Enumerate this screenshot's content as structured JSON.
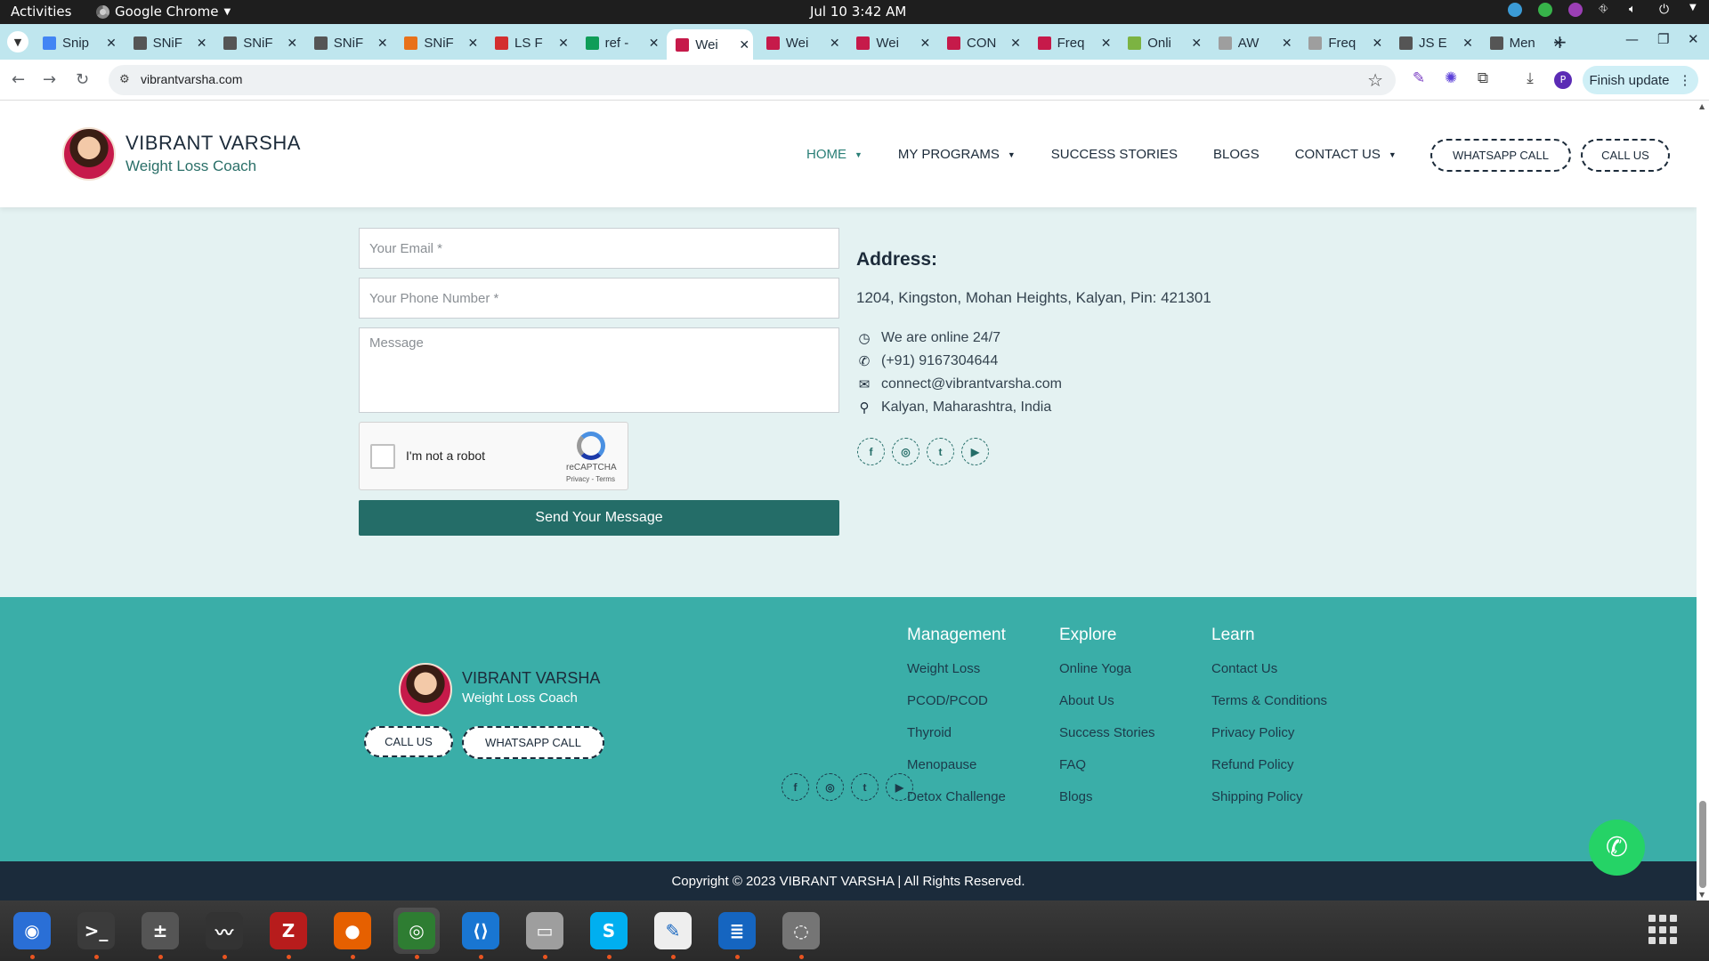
{
  "topbar": {
    "activities": "Activities",
    "app_menu": "Google Chrome",
    "clock": "Jul 10  3:42 AM"
  },
  "tabs": [
    {
      "title": "Snip",
      "favicon_color": "#4285f4",
      "active": false
    },
    {
      "title": "SNiF",
      "favicon_color": "#555555",
      "active": false
    },
    {
      "title": "SNiF",
      "favicon_color": "#555555",
      "active": false
    },
    {
      "title": "SNiF",
      "favicon_color": "#555555",
      "active": false
    },
    {
      "title": "SNiF",
      "favicon_color": "#e8711a",
      "active": false
    },
    {
      "title": "LS F",
      "favicon_color": "#d32f2f",
      "active": false
    },
    {
      "title": "ref -",
      "favicon_color": "#0f9d58",
      "active": false
    },
    {
      "title": "Wei",
      "favicon_color": "#c61a4a",
      "active": true
    },
    {
      "title": "Wei",
      "favicon_color": "#c61a4a",
      "active": false
    },
    {
      "title": "Wei",
      "favicon_color": "#c61a4a",
      "active": false
    },
    {
      "title": "CON",
      "favicon_color": "#c61a4a",
      "active": false
    },
    {
      "title": "Freq",
      "favicon_color": "#c61a4a",
      "active": false
    },
    {
      "title": "Onli",
      "favicon_color": "#7cb342",
      "active": false
    },
    {
      "title": "AW",
      "favicon_color": "#9e9e9e",
      "active": false
    },
    {
      "title": "Freq",
      "favicon_color": "#9e9e9e",
      "active": false
    },
    {
      "title": "JS E",
      "favicon_color": "#555555",
      "active": false
    },
    {
      "title": "Men",
      "favicon_color": "#555555",
      "active": false
    }
  ],
  "toolbar": {
    "url": "vibrantvarsha.com",
    "profile_initial": "P",
    "finish_update": "Finish update"
  },
  "site": {
    "brand_name": "VIBRANT VARSHA",
    "brand_tag": "Weight Loss Coach",
    "nav": [
      {
        "label": "HOME",
        "dropdown": true
      },
      {
        "label": "MY PROGRAMS",
        "dropdown": true
      },
      {
        "label": "SUCCESS STORIES",
        "dropdown": false
      },
      {
        "label": "BLOGS",
        "dropdown": false
      },
      {
        "label": "CONTACT US",
        "dropdown": true
      }
    ],
    "whatsapp_call": "WHATSAPP CALL",
    "call_us": "CALL US"
  },
  "form": {
    "email_placeholder": "Your Email *",
    "phone_placeholder": "Your Phone Number *",
    "message_placeholder": "Message",
    "captcha_label": "I'm not a robot",
    "captcha_brand": "reCAPTCHA",
    "captcha_links": "Privacy - Terms",
    "send_label": "Send Your Message"
  },
  "address": {
    "title": "Address:",
    "line": "1204, Kingston, Mohan Heights, Kalyan, Pin: 421301",
    "online": "We are online 24/7",
    "phone": "(+91) 9167304644",
    "email": "connect@vibrantvarsha.com",
    "location": "Kalyan, Maharashtra, India"
  },
  "social_icons": [
    "facebook-icon",
    "instagram-icon",
    "twitter-icon",
    "youtube-icon"
  ],
  "footer": {
    "brand_name": "VIBRANT VARSHA",
    "brand_tag": "Weight Loss Coach",
    "call_us": "CALL US",
    "whatsapp_call": "WHATSAPP CALL",
    "columns": [
      {
        "heading": "Management",
        "links": [
          "Weight Loss",
          "PCOD/PCOD",
          "Thyroid",
          "Menopause",
          "Detox Challenge"
        ]
      },
      {
        "heading": "Explore",
        "links": [
          "Online Yoga",
          "About Us",
          "Success Stories",
          "FAQ",
          "Blogs"
        ]
      },
      {
        "heading": "Learn",
        "links": [
          "Contact Us",
          "Terms & Conditions",
          "Privacy Policy",
          "Refund Policy",
          "Shipping Policy"
        ]
      }
    ],
    "copyright": "Copyright © 2023 VIBRANT VARSHA | All Rights Reserved."
  },
  "colors": {
    "accent": "#246d68",
    "footer_bg": "#3aaea8",
    "page_bg": "#e4f2f2",
    "copyright_bg": "#1b2b3b"
  },
  "dock_apps": [
    "thunderbird-icon",
    "terminal-icon",
    "calculator-icon",
    "system-monitor-icon",
    "filezilla-icon",
    "firefox-icon",
    "chrome-icon",
    "vscode-icon",
    "files-icon",
    "skype-icon",
    "text-editor-icon",
    "writer-icon",
    "disks-icon"
  ]
}
